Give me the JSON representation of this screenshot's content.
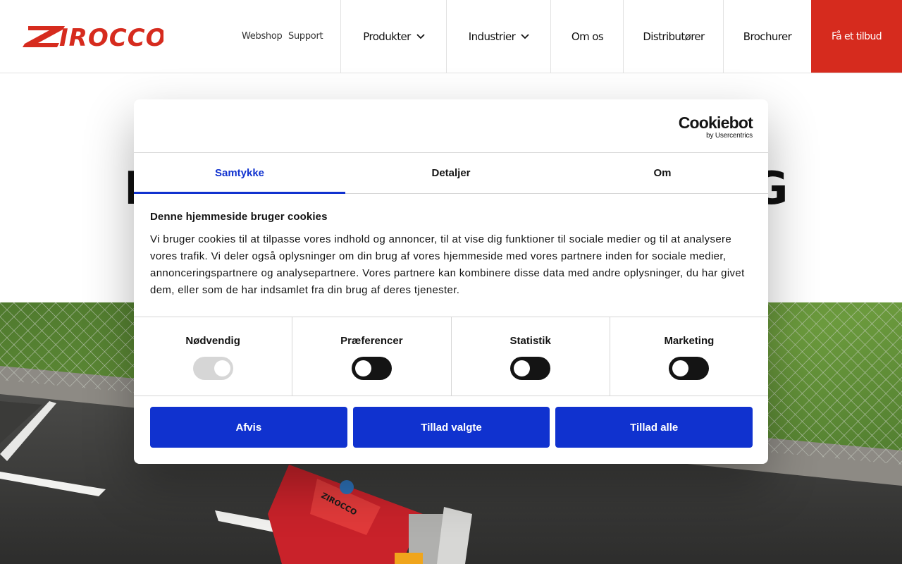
{
  "header": {
    "brand": "ZIROCCO",
    "utility_links": [
      "Webshop",
      "Support"
    ],
    "nav": [
      {
        "label": "Produkter",
        "has_dropdown": true
      },
      {
        "label": "Industrier",
        "has_dropdown": true
      },
      {
        "label": "Om os",
        "has_dropdown": false
      },
      {
        "label": "Distributører",
        "has_dropdown": false
      },
      {
        "label": "Brochurer",
        "has_dropdown": false
      }
    ],
    "cta_label": "Få et tilbud",
    "accent": "#d62b1e"
  },
  "hero": {
    "title_fragment_left": "L",
    "title_fragment_right": "G"
  },
  "cookie_dialog": {
    "provider_logo": "Cookiebot",
    "provider_sub": "by Usercentrics",
    "tabs": [
      {
        "label": "Samtykke",
        "active": true
      },
      {
        "label": "Detaljer",
        "active": false
      },
      {
        "label": "Om",
        "active": false
      }
    ],
    "heading": "Denne hjemmeside bruger cookies",
    "description": "Vi bruger cookies til at tilpasse vores indhold og annoncer, til at vise dig funktioner til sociale medier og til at analysere vores trafik. Vi deler også oplysninger om din brug af vores hjemmeside med vores partnere inden for sociale medier, annonceringspartnere og analysepartnere. Vores partnere kan kombinere disse data med andre oplysninger, du har givet dem, eller som de har indsamlet fra din brug af deres tjenester.",
    "categories": [
      {
        "label": "Nødvendig",
        "enabled": true,
        "disabled": true
      },
      {
        "label": "Præferencer",
        "enabled": false,
        "disabled": false
      },
      {
        "label": "Statistik",
        "enabled": false,
        "disabled": false
      },
      {
        "label": "Marketing",
        "enabled": false,
        "disabled": false
      }
    ],
    "buttons": {
      "deny": "Afvis",
      "allow_selected": "Tillad valgte",
      "allow_all": "Tillad alle"
    },
    "button_color": "#1032cf"
  }
}
